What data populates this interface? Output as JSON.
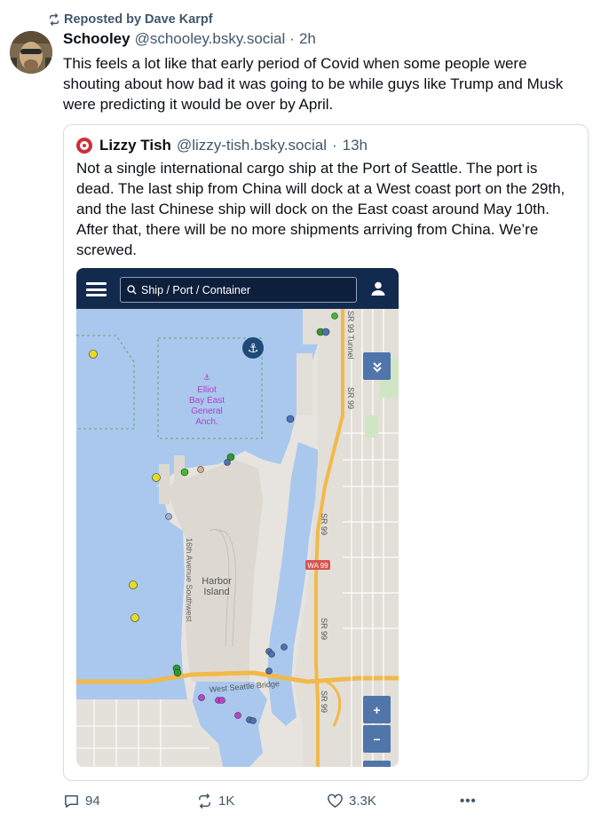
{
  "repost": {
    "label": "Reposted by Dave Karpf",
    "icon": "repost-icon"
  },
  "post": {
    "author_name": "Schooley",
    "author_handle": "@schooley.bsky.social",
    "separator": "·",
    "time": "2h",
    "text": "This feels a lot like that early period of Covid when some people were shouting about how bad it was going to be while guys like Trump and Musk were predicting it would be over by April."
  },
  "quote": {
    "author_name": "Lizzy Tish",
    "author_handle": "@lizzy-tish.bsky.social",
    "separator": "·",
    "time": "13h",
    "text": "Not a single international cargo ship at the Port of Seattle. The port is dead. The last ship from China will dock at a West coast port on the 29th, and the last Chinese ship will dock on the East coast around May 10th. After that, there will be no more shipments arriving from China. We’re screwed."
  },
  "map": {
    "search_placeholder": "Ship / Port / Container",
    "anchorage_label": [
      "Elliot",
      "Bay East",
      "General",
      "Anch."
    ],
    "island_label": [
      "Harbor",
      "Island"
    ],
    "road_labels": {
      "sr99_tunnel": "SR 99 Tunnel",
      "sr99_a": "SR 99",
      "sr99_b": "SR 99",
      "sr99_c": "SR 99",
      "sr99_d": "SR 99",
      "wa99": "WA 99",
      "sixteenth": "16th Avenue Southwest",
      "west_seattle_bridge": "West Seattle Bridge"
    },
    "zoom_in": "+",
    "zoom_out": "−",
    "colors": {
      "topbar": "#122a4d",
      "water": "#aac8ee",
      "land": "#e7e4df",
      "highway": "#f2b94a",
      "ship_yellow": "#e6dc1e",
      "ship_green": "#3fbf2a",
      "ship_blue": "#4b72b3",
      "ship_magenta": "#c43ed0"
    }
  },
  "actions": {
    "replies": "94",
    "reposts": "1K",
    "likes": "3.3K",
    "more": "•••"
  }
}
